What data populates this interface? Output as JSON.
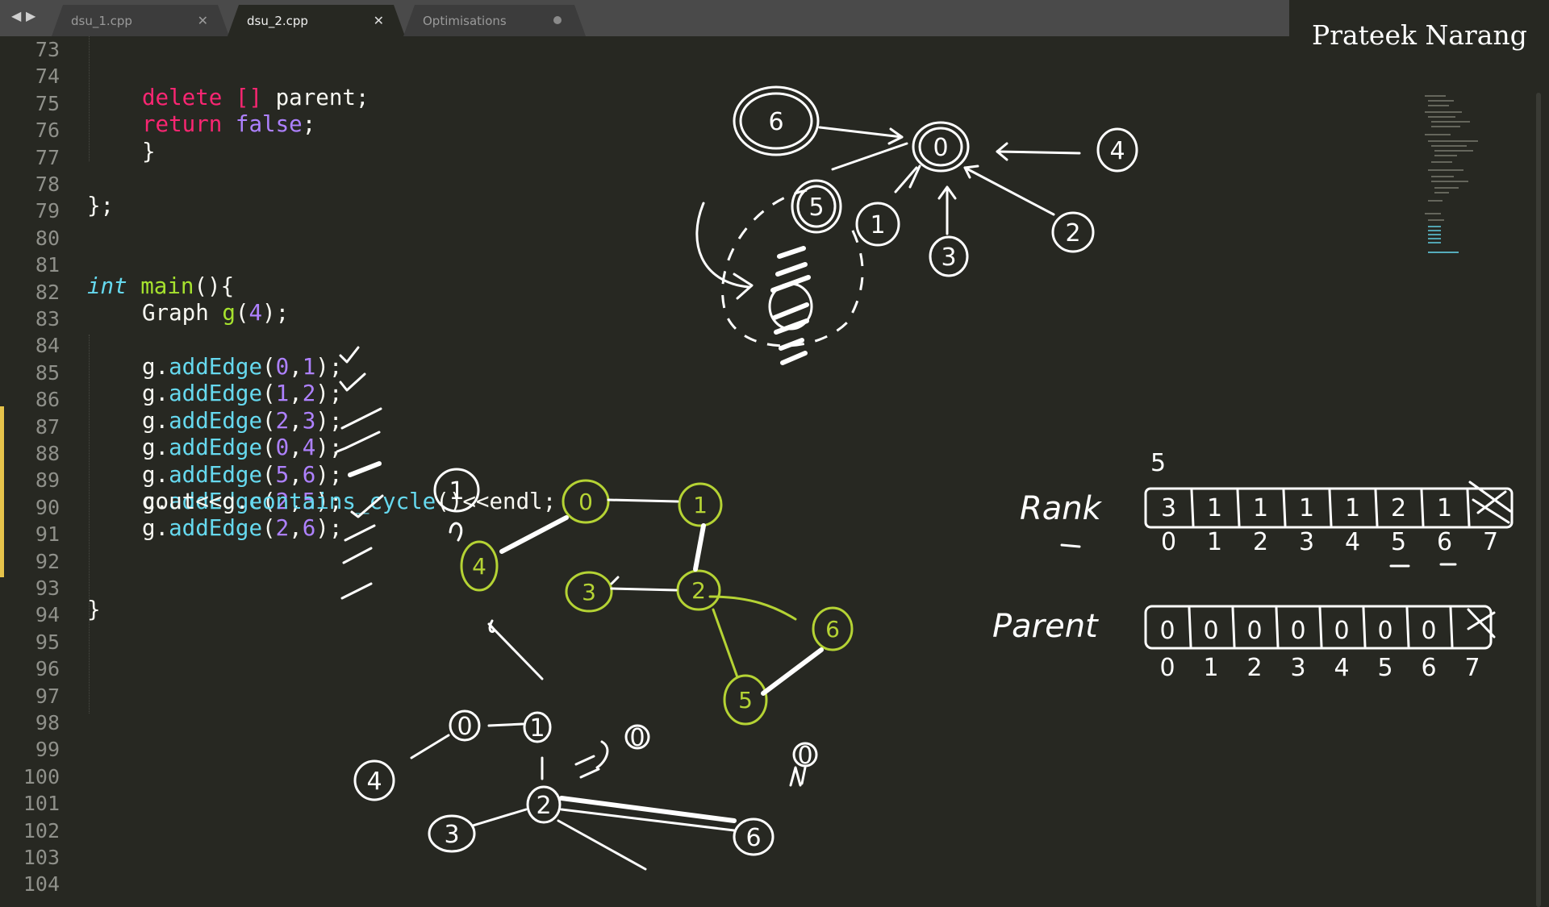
{
  "tabs": [
    {
      "label": "dsu_1.cpp",
      "state": "inactive",
      "close_icon": "close-icon"
    },
    {
      "label": "dsu_2.cpp",
      "state": "active",
      "close_icon": "close-icon"
    },
    {
      "label": "Optimisations",
      "state": "inactive",
      "close_icon": "unsaved-dot-icon"
    }
  ],
  "nav": {
    "back_icon": "back-arrow-icon",
    "forward_icon": "forward-arrow-icon"
  },
  "author": "Prateek Narang",
  "gutter": {
    "line_numbers": [
      "73",
      "74",
      "75",
      "76",
      "77",
      "78",
      "79",
      "80",
      "81",
      "82",
      "83",
      "84",
      "85",
      "86",
      "87",
      "88",
      "89",
      "90",
      "91",
      "92",
      "93",
      "94",
      "95",
      "96",
      "97",
      "98",
      "99",
      "100",
      "101",
      "102",
      "103",
      "104"
    ]
  },
  "code": {
    "l75": {
      "kw": "delete",
      "brackets": "[]",
      "rest": " parent;"
    },
    "l76": {
      "kw": "return",
      "val": "false",
      "semi": ";"
    },
    "l77": {
      "text": "}"
    },
    "l79": {
      "text": "};"
    },
    "l82": {
      "type": "int",
      "fn": "main",
      "rest": "(){"
    },
    "l83": {
      "cls": "Graph",
      "obj": "g",
      "open": "(",
      "num": "4",
      "close": ");"
    },
    "edges": [
      {
        "obj": "g.",
        "method": "addEdge",
        "a": "0",
        "b": "1"
      },
      {
        "obj": "g.",
        "method": "addEdge",
        "a": "1",
        "b": "2"
      },
      {
        "obj": "g.",
        "method": "addEdge",
        "a": "2",
        "b": "3"
      },
      {
        "obj": "g.",
        "method": "addEdge",
        "a": "0",
        "b": "4"
      },
      {
        "obj": "g.",
        "method": "addEdge",
        "a": "5",
        "b": "6"
      },
      {
        "obj": "g.",
        "method": "addEdge",
        "a": "2",
        "b": "5"
      },
      {
        "obj": "g.",
        "method": "addEdge",
        "a": "2",
        "b": "6"
      }
    ],
    "l93": {
      "pre": "cout<<g.",
      "method": "contains_cycle",
      "post": "()<<endl;"
    },
    "l97": {
      "text": "}"
    }
  },
  "annotations": {
    "rank_label": "Rank",
    "parent_label": "Parent",
    "rank_values": [
      "3",
      "1",
      "1",
      "1",
      "1",
      "2",
      "1",
      ""
    ],
    "parent_values": [
      "0",
      "0",
      "0",
      "0",
      "0",
      "0",
      "0",
      ""
    ],
    "indices": [
      "0",
      "1",
      "2",
      "3",
      "4",
      "5",
      "6",
      "7"
    ],
    "rank_note": "5",
    "tree": {
      "root": "0",
      "children": [
        "6",
        "4",
        "5",
        "1",
        "3",
        "2"
      ]
    },
    "graph_nodes": [
      "0",
      "1",
      "4",
      "3",
      "2",
      "6",
      "5",
      "1"
    ],
    "lower_graph_nodes": [
      "0",
      "1",
      "4",
      "2",
      "3",
      "6",
      "0",
      "0"
    ],
    "ink_color": "#ffffff",
    "highlight_color": "#b5d334"
  }
}
